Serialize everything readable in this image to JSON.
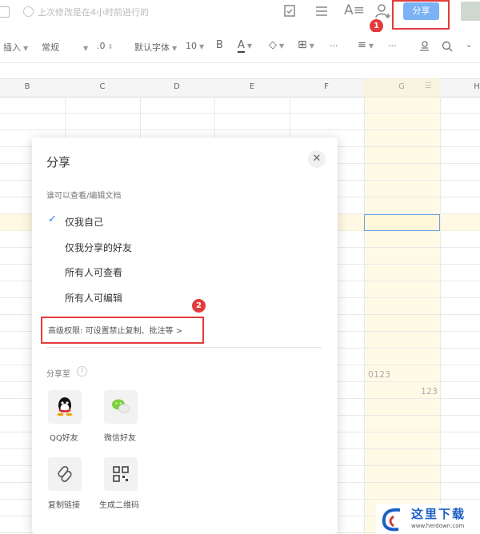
{
  "topbar": {
    "save_status": "上次修改是在4小时前进行的",
    "share_button": "分享",
    "badge1": "1"
  },
  "toolbar": {
    "insert": "插入",
    "format": "常规",
    "decimal": ".0",
    "font": "默认字体",
    "size": "10",
    "bold": "B",
    "font_color": "A",
    "more": "···",
    "align": "≡",
    "more2": "···"
  },
  "columns": [
    "B",
    "C",
    "D",
    "E",
    "F",
    "G",
    "H"
  ],
  "cells": {
    "g_text": "0123",
    "g_num": "123"
  },
  "popup": {
    "title": "分享",
    "section_label": "谁可以查看/编辑文档",
    "options": [
      {
        "label": "仅我自己",
        "selected": true
      },
      {
        "label": "仅我分享的好友",
        "selected": false
      },
      {
        "label": "所有人可查看",
        "selected": false
      },
      {
        "label": "所有人可编辑",
        "selected": false
      }
    ],
    "badge2": "2",
    "advanced": "高级权限: 可设置禁止复制、批注等 >",
    "share_to": "分享至",
    "targets": [
      {
        "label": "QQ好友",
        "icon": "qq-icon"
      },
      {
        "label": "微信好友",
        "icon": "wechat-icon"
      },
      {
        "label": "复制链接",
        "icon": "link-icon"
      },
      {
        "label": "生成二维码",
        "icon": "qrcode-icon"
      }
    ]
  },
  "watermark": {
    "brand": "这里下载",
    "url": "www.herdown.com"
  },
  "colors": {
    "accent": "#2f7cf6",
    "highlight": "#e33b3b",
    "share_btn": "#7ab2f5"
  }
}
